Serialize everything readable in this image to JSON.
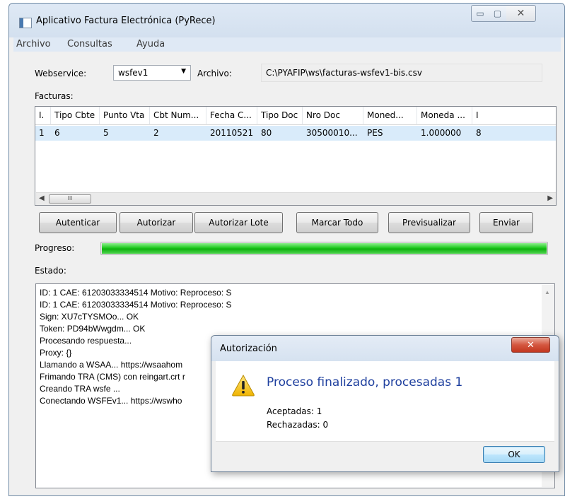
{
  "window": {
    "title": "Aplicativo Factura Electrónica (PyRece)",
    "controls": {
      "minimize": "▭",
      "maximize": "▢",
      "close": "✕"
    }
  },
  "menu": [
    "Archivo",
    "Consultas",
    "Ayuda"
  ],
  "form": {
    "webservice_label": "Webservice:",
    "webservice_value": "wsfev1",
    "archivo_label": "Archivo:",
    "archivo_value": "C:\\PYAFIP\\ws\\facturas-wsfev1-bis.csv",
    "facturas_label": "Facturas:"
  },
  "table": {
    "columns": [
      "I.",
      "Tipo Cbte",
      "Punto Vta",
      "Cbt Num...",
      "Fecha C...",
      "Tipo Doc",
      "Nro Doc",
      "Moned...",
      "Moneda ...",
      "I"
    ],
    "rows": [
      [
        "1",
        "6",
        "5",
        "2",
        "20110521",
        "80",
        "30500010...",
        "PES",
        "1.000000",
        "8"
      ]
    ],
    "scroll_thumb": "III"
  },
  "buttons": {
    "autenticar": "Autenticar",
    "autorizar": "Autorizar",
    "autorizar_lote": "Autorizar Lote",
    "marcar_todo": "Marcar Todo",
    "previsualizar": "Previsualizar",
    "enviar": "Enviar"
  },
  "progress": {
    "label": "Progreso:",
    "value": 1.0,
    "color": "#1ec81e"
  },
  "estado": {
    "label": "Estado:",
    "lines": [
      "ID: 1 CAE: 61203033334514 Motivo:  Reproceso: S",
      "ID: 1 CAE: 61203033334514 Motivo:  Reproceso: S",
      "Sign: XU7cTYSMOo... OK",
      "Token: PD94bWwgdm... OK",
      "Procesando respuesta...",
      "Proxy: {}",
      "Llamando a WSAA... https://wsaahom",
      "Frimando TRA (CMS) con reingart.crt r",
      "Creando TRA wsfe ...",
      "Conectando WSFEv1... https://wswho"
    ]
  },
  "dialog": {
    "title": "Autorización",
    "close": "✕",
    "icon": "warning-icon",
    "message": "Proceso finalizado, procesadas 1",
    "aceptadas": "Aceptadas: 1",
    "rechazadas": "Rechazadas: 0",
    "ok": "OK"
  }
}
